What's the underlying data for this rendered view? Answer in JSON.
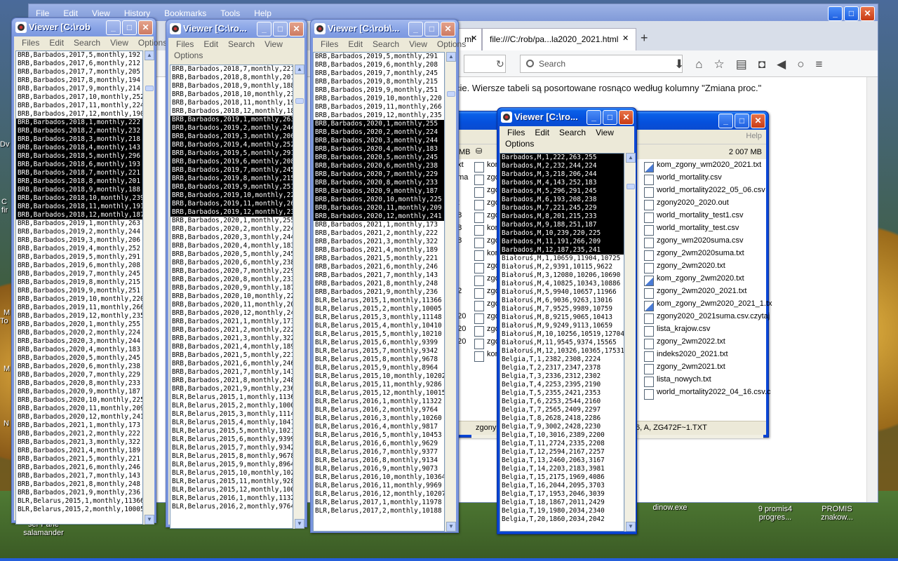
{
  "firefox": {
    "menu": [
      "File",
      "Edit",
      "View",
      "History",
      "Bookmarks",
      "Tools",
      "Help"
    ],
    "tab1_label": "ml",
    "tab2_label": "file:///C:/rob/pa...la2020_2021.html",
    "search_placeholder": "Search",
    "content_text": "cie. Wiersze tabeli są posortowane rosnąco według kolumny \"Zmiana proc.\""
  },
  "viewer1": {
    "title": "Viewer [C:\\rob",
    "menu": [
      "Files",
      "Edit",
      "Search",
      "View",
      "Options"
    ],
    "lines": [
      "BRB,Barbados,2017,5,monthly,192",
      "BRB,Barbados,2017,6,monthly,212",
      "BRB,Barbados,2017,7,monthly,205",
      "BRB,Barbados,2017,8,monthly,194",
      "BRB,Barbados,2017,9,monthly,214",
      "BRB,Barbados,2017,10,monthly,252",
      "BRB,Barbados,2017,11,monthly,224",
      "BRB,Barbados,2017,12,monthly,190",
      "BRB,Barbados,2018,1,monthly,222",
      "BRB,Barbados,2018,2,monthly,232",
      "BRB,Barbados,2018,3,monthly,218",
      "BRB,Barbados,2018,4,monthly,143",
      "BRB,Barbados,2018,5,monthly,296",
      "BRB,Barbados,2018,6,monthly,193",
      "BRB,Barbados,2018,7,monthly,221",
      "BRB,Barbados,2018,8,monthly,201",
      "BRB,Barbados,2018,9,monthly,188",
      "BRB,Barbados,2018,10,monthly,239",
      "BRB,Barbados,2018,11,monthly,191",
      "BRB,Barbados,2018,12,monthly,187",
      "BRB,Barbados,2019,1,monthly,263",
      "BRB,Barbados,2019,2,monthly,244",
      "BRB,Barbados,2019,3,monthly,206",
      "BRB,Barbados,2019,4,monthly,252",
      "BRB,Barbados,2019,5,monthly,291",
      "BRB,Barbados,2019,6,monthly,208",
      "BRB,Barbados,2019,7,monthly,245",
      "BRB,Barbados,2019,8,monthly,215",
      "BRB,Barbados,2019,9,monthly,251",
      "BRB,Barbados,2019,10,monthly,220",
      "BRB,Barbados,2019,11,monthly,266",
      "BRB,Barbados,2019,12,monthly,235",
      "BRB,Barbados,2020,1,monthly,255",
      "BRB,Barbados,2020,2,monthly,224",
      "BRB,Barbados,2020,3,monthly,244",
      "BRB,Barbados,2020,4,monthly,183",
      "BRB,Barbados,2020,5,monthly,245",
      "BRB,Barbados,2020,6,monthly,238",
      "BRB,Barbados,2020,7,monthly,229",
      "BRB,Barbados,2020,8,monthly,233",
      "BRB,Barbados,2020,9,monthly,187",
      "BRB,Barbados,2020,10,monthly,225",
      "BRB,Barbados,2020,11,monthly,209",
      "BRB,Barbados,2020,12,monthly,241",
      "BRB,Barbados,2021,1,monthly,173",
      "BRB,Barbados,2021,2,monthly,222",
      "BRB,Barbados,2021,3,monthly,322",
      "BRB,Barbados,2021,4,monthly,189",
      "BRB,Barbados,2021,5,monthly,221",
      "BRB,Barbados,2021,6,monthly,246",
      "BRB,Barbados,2021,7,monthly,143",
      "BRB,Barbados,2021,8,monthly,248",
      "BRB,Barbados,2021,9,monthly,236",
      "BLR,Belarus,2015,1,monthly,11366",
      "BLR,Belarus,2015,2,monthly,10005"
    ]
  },
  "viewer2": {
    "title": "Viewer [C:\\ro...",
    "menu": [
      "Files",
      "Edit",
      "Search",
      "View"
    ],
    "options_label": "Options",
    "lines": [
      "BRB,Barbados,2018,7,monthly,221",
      "BRB,Barbados,2018,8,monthly,201",
      "BRB,Barbados,2018,9,monthly,188",
      "BRB,Barbados,2018,10,monthly,239",
      "BRB,Barbados,2018,11,monthly,191",
      "BRB,Barbados,2018,12,monthly,187",
      "BRB,Barbados,2019,1,monthly,263",
      "BRB,Barbados,2019,2,monthly,244",
      "BRB,Barbados,2019,3,monthly,206",
      "BRB,Barbados,2019,4,monthly,252",
      "BRB,Barbados,2019,5,monthly,291",
      "BRB,Barbados,2019,6,monthly,208",
      "BRB,Barbados,2019,7,monthly,245",
      "BRB,Barbados,2019,8,monthly,215",
      "BRB,Barbados,2019,9,monthly,251",
      "BRB,Barbados,2019,10,monthly,220",
      "BRB,Barbados,2019,11,monthly,266",
      "BRB,Barbados,2019,12,monthly,235",
      "BRB,Barbados,2020,1,monthly,255",
      "BRB,Barbados,2020,2,monthly,224",
      "BRB,Barbados,2020,3,monthly,244",
      "BRB,Barbados,2020,4,monthly,183",
      "BRB,Barbados,2020,5,monthly,245",
      "BRB,Barbados,2020,6,monthly,238",
      "BRB,Barbados,2020,7,monthly,229",
      "BRB,Barbados,2020,8,monthly,233",
      "BRB,Barbados,2020,9,monthly,187",
      "BRB,Barbados,2020,10,monthly,225",
      "BRB,Barbados,2020,11,monthly,209",
      "BRB,Barbados,2020,12,monthly,241",
      "BRB,Barbados,2021,1,monthly,173",
      "BRB,Barbados,2021,2,monthly,222",
      "BRB,Barbados,2021,3,monthly,322",
      "BRB,Barbados,2021,4,monthly,189",
      "BRB,Barbados,2021,5,monthly,221",
      "BRB,Barbados,2021,6,monthly,246",
      "BRB,Barbados,2021,7,monthly,143",
      "BRB,Barbados,2021,8,monthly,248",
      "BRB,Barbados,2021,9,monthly,236",
      "BLR,Belarus,2015,1,monthly,11366",
      "BLR,Belarus,2015,2,monthly,10005",
      "BLR,Belarus,2015,3,monthly,11148",
      "BLR,Belarus,2015,4,monthly,10410",
      "BLR,Belarus,2015,5,monthly,10210",
      "BLR,Belarus,2015,6,monthly,9399",
      "BLR,Belarus,2015,7,monthly,9342",
      "BLR,Belarus,2015,8,monthly,9678",
      "BLR,Belarus,2015,9,monthly,8964",
      "BLR,Belarus,2015,10,monthly,10202",
      "BLR,Belarus,2015,11,monthly,9286",
      "BLR,Belarus,2015,12,monthly,10015",
      "BLR,Belarus,2016,1,monthly,11322",
      "BLR,Belarus,2016,2,monthly,9764"
    ]
  },
  "viewer3": {
    "title": "Viewer [C:\\rob\\...",
    "menu": [
      "Files",
      "Edit",
      "Search",
      "View",
      "Options"
    ],
    "lines": [
      "BRB,Barbados,2019,5,monthly,291",
      "BRB,Barbados,2019,6,monthly,208",
      "BRB,Barbados,2019,7,monthly,245",
      "BRB,Barbados,2019,8,monthly,215",
      "BRB,Barbados,2019,9,monthly,251",
      "BRB,Barbados,2019,10,monthly,220",
      "BRB,Barbados,2019,11,monthly,266",
      "BRB,Barbados,2019,12,monthly,235",
      "BRB,Barbados,2020,1,monthly,255",
      "BRB,Barbados,2020,2,monthly,224",
      "BRB,Barbados,2020,3,monthly,244",
      "BRB,Barbados,2020,4,monthly,183",
      "BRB,Barbados,2020,5,monthly,245",
      "BRB,Barbados,2020,6,monthly,238",
      "BRB,Barbados,2020,7,monthly,229",
      "BRB,Barbados,2020,8,monthly,233",
      "BRB,Barbados,2020,9,monthly,187",
      "BRB,Barbados,2020,10,monthly,225",
      "BRB,Barbados,2020,11,monthly,209",
      "BRB,Barbados,2020,12,monthly,241",
      "BRB,Barbados,2021,1,monthly,173",
      "BRB,Barbados,2021,2,monthly,222",
      "BRB,Barbados,2021,3,monthly,322",
      "BRB,Barbados,2021,4,monthly,189",
      "BRB,Barbados,2021,5,monthly,221",
      "BRB,Barbados,2021,6,monthly,246",
      "BRB,Barbados,2021,7,monthly,143",
      "BRB,Barbados,2021,8,monthly,248",
      "BRB,Barbados,2021,9,monthly,236",
      "BLR,Belarus,2015,1,monthly,11366",
      "BLR,Belarus,2015,2,monthly,10005",
      "BLR,Belarus,2015,3,monthly,11148",
      "BLR,Belarus,2015,4,monthly,10410",
      "BLR,Belarus,2015,5,monthly,10210",
      "BLR,Belarus,2015,6,monthly,9399",
      "BLR,Belarus,2015,7,monthly,9342",
      "BLR,Belarus,2015,8,monthly,9678",
      "BLR,Belarus,2015,9,monthly,8964",
      "BLR,Belarus,2015,10,monthly,10202",
      "BLR,Belarus,2015,11,monthly,9286",
      "BLR,Belarus,2015,12,monthly,10015",
      "BLR,Belarus,2016,1,monthly,11322",
      "BLR,Belarus,2016,2,monthly,9764",
      "BLR,Belarus,2016,3,monthly,10260",
      "BLR,Belarus,2016,4,monthly,9817",
      "BLR,Belarus,2016,5,monthly,10453",
      "BLR,Belarus,2016,6,monthly,9629",
      "BLR,Belarus,2016,7,monthly,9377",
      "BLR,Belarus,2016,8,monthly,9134",
      "BLR,Belarus,2016,9,monthly,9073",
      "BLR,Belarus,2016,10,monthly,10364",
      "BLR,Belarus,2016,11,monthly,9969",
      "BLR,Belarus,2016,12,monthly,10207",
      "BLR,Belarus,2017,1,monthly,11978",
      "BLR,Belarus,2017,2,monthly,10188"
    ]
  },
  "viewer4": {
    "title": "Viewer [C:\\ro...",
    "menu": [
      "Files",
      "Edit",
      "Search",
      "View"
    ],
    "options_label": "Options",
    "lines": [
      "Barbados,M,1,222,263,255",
      "Barbados,M,2,232,244,224",
      "Barbados,M,3,218,206,244",
      "Barbados,M,4,143,252,183",
      "Barbados,M,5,296,291,245",
      "Barbados,M,6,193,208,238",
      "Barbados,M,7,221,245,229",
      "Barbados,M,8,201,215,233",
      "Barbados,M,9,188,251,187",
      "Barbados,M,10,239,220,225",
      "Barbados,M,11,191,266,209",
      "Barbados,M,12,187,235,241",
      "Białoruś,M,1,10659,11904,10725",
      "Białoruś,M,2,9391,10115,9622",
      "Białoruś,M,3,12080,10206,10690",
      "Białoruś,M,4,10825,10343,10886",
      "Białoruś,M,5,9940,10657,11966",
      "Białoruś,M,6,9036,9263,13016",
      "Białoruś,M,7,9525,9989,10759",
      "Białoruś,M,8,9215,9065,10413",
      "Białoruś,M,9,9249,9113,10659",
      "Białoruś,M,10,10256,10519,12704",
      "Białoruś,M,11,9545,9374,15565",
      "Białoruś,M,12,10326,10365,17531",
      "Belgia,T,1,2382,2308,2224",
      "Belgia,T,2,2317,2347,2378",
      "Belgia,T,3,2336,2312,2302",
      "Belgia,T,4,2253,2395,2190",
      "Belgia,T,5,2355,2421,2353",
      "Belgia,T,6,2253,2544,2160",
      "Belgia,T,7,2565,2409,2297",
      "Belgia,T,8,2628,2418,2286",
      "Belgia,T,9,3002,2428,2230",
      "Belgia,T,10,3016,2389,2200",
      "Belgia,T,11,2724,2335,2208",
      "Belgia,T,12,2594,2167,2257",
      "Belgia,T,13,2460,2063,3167",
      "Belgia,T,14,2203,2183,3981",
      "Belgia,T,15,2175,1969,4086",
      "Belgia,T,16,2044,2095,3703",
      "Belgia,T,17,1953,2046,3039",
      "Belgia,T,18,1867,2011,2429",
      "Belgia,T,19,1980,2034,2340",
      "Belgia,T,20,1860,2034,2042"
    ]
  },
  "explorer": {
    "help_label": "Help",
    "disk_free": "2 007 MB",
    "disk_label": "MB",
    "status_path": "6, A, ZG472F~1.TXT",
    "status_left": "zgony",
    "files": [
      "kom_zgony_wm2020_2021.txt",
      "world_mortality.csv",
      "world_mortality2022_05_06.csv",
      "zgony2020_2020.out",
      "world_mortality_test1.csv",
      "world_mortality_test.csv",
      "zgony_wm2020suma.csv",
      "zgony_2wm2020suma.txt",
      "zgony_2wm2020.txt",
      "kom_zgony_2wm2020.txt",
      "zgony_2wm2020_2021.txt",
      "kom_zgony_2wm2020_2021_1.tx",
      "zgony2020_2021suma.csv.czytaj",
      "lista_krajow.csv",
      "zgony_2wm2022.txt",
      "indeks2020_2021.txt",
      "zgony_2wm2021.txt",
      "lista_nowych.txt",
      "world_mortality2022_04_16.csv.c"
    ],
    "left_items": [
      "kom",
      "zgo",
      "zgo",
      "zgo",
      "zgo",
      "kom",
      "zgo",
      "kom",
      "zgo",
      "zgo",
      "zgo",
      "zgo",
      "zgo",
      "zgo",
      "zgo",
      "kom"
    ],
    "left_ext": [
      ".txt",
      "uma",
      "",
      "xt",
      "08",
      "08",
      "08",
      "",
      "",
      "",
      "12",
      "",
      "d20",
      "d20",
      "d20",
      ""
    ]
  },
  "desktop": {
    "icons": [
      "ser Pane\nsalamander",
      "dinow.exe",
      "9 promis4\nprogres...",
      "PROMIS\nznakow..."
    ],
    "left_edge_labels": [
      "Dv",
      "C",
      "fir",
      "M",
      "To",
      "M",
      "N"
    ]
  }
}
